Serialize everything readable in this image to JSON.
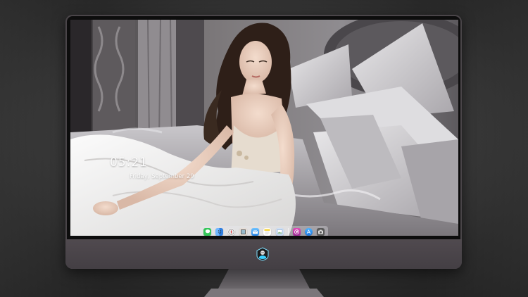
{
  "lock_screen": {
    "time": "05:21",
    "date": "Friday, September 29"
  },
  "dock": {
    "apps": [
      {
        "name": "messages-icon",
        "color": "#34c759"
      },
      {
        "name": "finder-icon",
        "color": "#3a8ef6"
      },
      {
        "name": "safari-icon",
        "color": "#f2f2f2"
      },
      {
        "name": "photos-icon",
        "color": "#e8e0d8"
      },
      {
        "name": "mail-icon",
        "color": "#6aa8ee"
      },
      {
        "name": "notes-icon",
        "color": "#f5d33c"
      },
      {
        "name": "preview-icon",
        "color": "#8fb5e8"
      },
      {
        "name": "separator"
      },
      {
        "name": "launchpad-icon",
        "color": "#c43aa8"
      },
      {
        "name": "itunes-icon",
        "color": "#d75cc7"
      },
      {
        "name": "app-store-icon",
        "color": "#2f8fef"
      },
      {
        "name": "camera-icon",
        "color": "#5a5a5a"
      }
    ]
  },
  "colors": {
    "monitor_body": "#4a4549",
    "accent_logo": "#3ad0ff"
  }
}
